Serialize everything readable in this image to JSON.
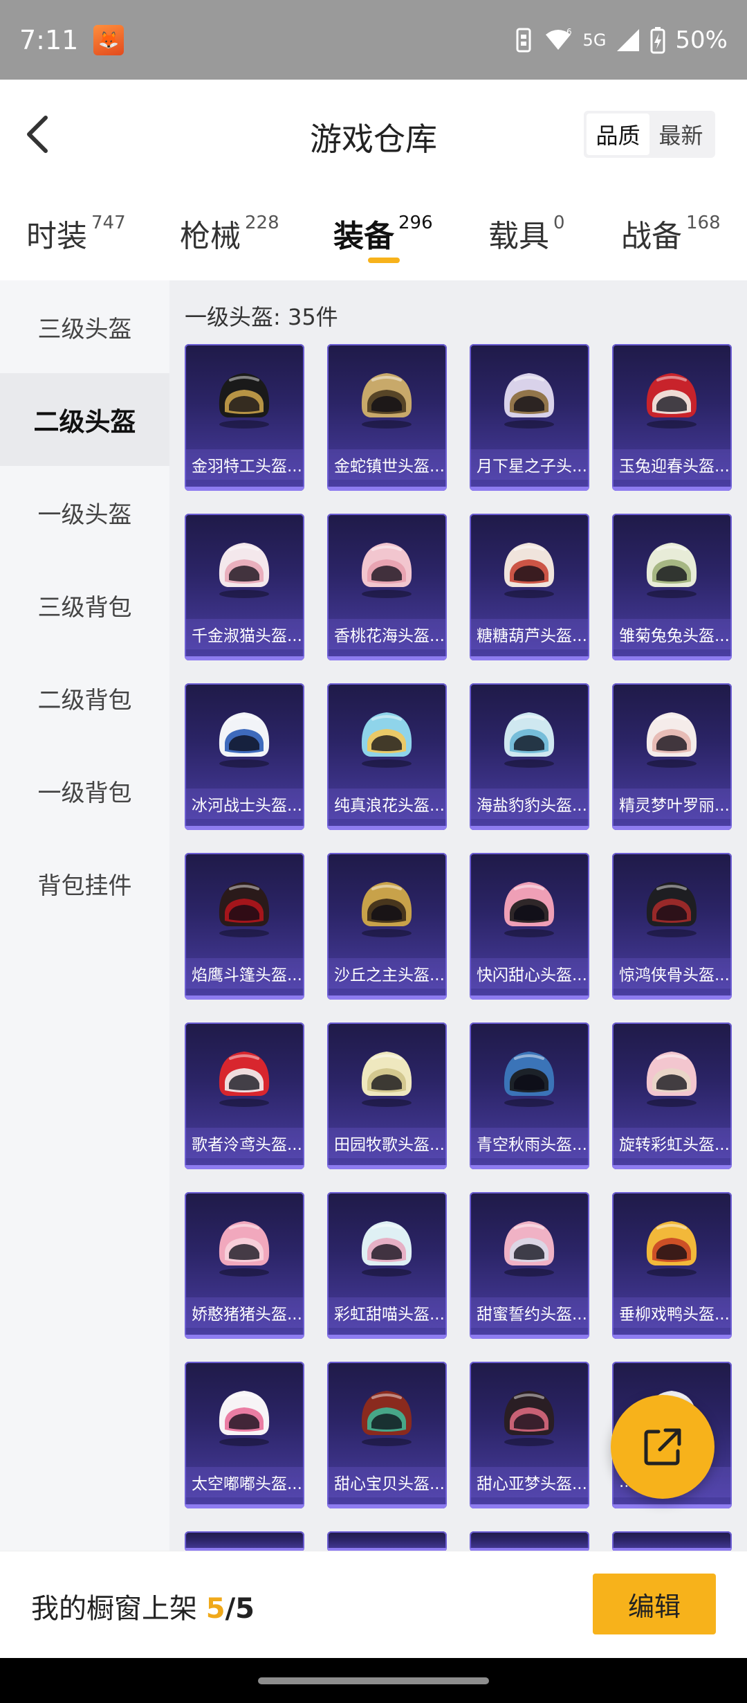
{
  "status_bar": {
    "time": "7:11",
    "battery": "50%",
    "network": "5G"
  },
  "header": {
    "title": "游戏仓库",
    "sort_options": [
      "品质",
      "最新"
    ]
  },
  "tabs": [
    {
      "label": "时装",
      "count": "747"
    },
    {
      "label": "枪械",
      "count": "228"
    },
    {
      "label": "装备",
      "count": "296",
      "active": true
    },
    {
      "label": "载具",
      "count": "0"
    },
    {
      "label": "战备",
      "count": "168"
    }
  ],
  "sidebar": {
    "items": [
      "三级头盔",
      "二级头盔",
      "一级头盔",
      "三级背包",
      "二级背包",
      "一级背包",
      "背包挂件"
    ],
    "active_index": 1
  },
  "content": {
    "section_title": "一级头盔: 35件",
    "items": [
      {
        "name": "金羽特工头盔...",
        "color": "#1a1a1a",
        "accent": "#c9a24a"
      },
      {
        "name": "金蛇镇世头盔...",
        "color": "#c8a96a",
        "accent": "#4a3a20"
      },
      {
        "name": "月下星之子头...",
        "color": "#d9d2ea",
        "accent": "#8a6a3a"
      },
      {
        "name": "玉兔迎春头盔...",
        "color": "#c8232b",
        "accent": "#f2efe8"
      },
      {
        "name": "千金淑猫头盔...",
        "color": "#f4e8ec",
        "accent": "#e8a8b8"
      },
      {
        "name": "香桃花海头盔...",
        "color": "#f2c6cf",
        "accent": "#e7a0ae"
      },
      {
        "name": "糖糖葫芦头盔...",
        "color": "#f0e4dc",
        "accent": "#c84535"
      },
      {
        "name": "雏菊兔兔头盔...",
        "color": "#e8ecd8",
        "accent": "#9fb17a"
      },
      {
        "name": "冰河战士头盔...",
        "color": "#f2f4f8",
        "accent": "#2a5bb5"
      },
      {
        "name": "纯真浪花头盔...",
        "color": "#8fd4ea",
        "accent": "#f3c85a"
      },
      {
        "name": "海盐豹豹头盔...",
        "color": "#cfe8f0",
        "accent": "#6bb8d6"
      },
      {
        "name": "精灵梦叶罗丽...",
        "color": "#f5ecea",
        "accent": "#e6b7b0"
      },
      {
        "name": "焰鹰斗篷头盔...",
        "color": "#2a1a1a",
        "accent": "#b1151c"
      },
      {
        "name": "沙丘之主头盔...",
        "color": "#c8a24a",
        "accent": "#3a2a18"
      },
      {
        "name": "快闪甜心头盔...",
        "color": "#ef9fb6",
        "accent": "#1a1a1a"
      },
      {
        "name": "惊鸿侠骨头盔...",
        "color": "#1e1e22",
        "accent": "#a52a2a"
      },
      {
        "name": "歌者泠鸢头盔...",
        "color": "#d8262e",
        "accent": "#f2f2f2"
      },
      {
        "name": "田园牧歌头盔...",
        "color": "#efe8bf",
        "accent": "#cfc48a"
      },
      {
        "name": "青空秋雨头盔...",
        "color": "#3b74b8",
        "accent": "#1a1a1a"
      },
      {
        "name": "旋转彩虹头盔...",
        "color": "#f3c6cf",
        "accent": "#e8d6c6"
      },
      {
        "name": "娇憨猪猪头盔...",
        "color": "#f1a8bd",
        "accent": "#f7d1dc"
      },
      {
        "name": "彩虹甜喵头盔...",
        "color": "#dff0f4",
        "accent": "#e7a8c0"
      },
      {
        "name": "甜蜜誓约头盔...",
        "color": "#f0b2c5",
        "accent": "#d9d9e8"
      },
      {
        "name": "垂柳戏鸭头盔...",
        "color": "#f2b83a",
        "accent": "#c94525"
      },
      {
        "name": "太空嘟嘟头盔...",
        "color": "#f7f4f6",
        "accent": "#e8709a"
      },
      {
        "name": "甜心宝贝头盔...",
        "color": "#8a2a1e",
        "accent": "#3fb594"
      },
      {
        "name": "甜心亚梦头盔...",
        "color": "#2a1e24",
        "accent": "#d9687e"
      },
      {
        "name": "...",
        "color": "#eeeef2",
        "accent": "#f2c64a"
      }
    ]
  },
  "bottom_bar": {
    "showcase_label": "我的橱窗上架 ",
    "current": "5",
    "separator": "/",
    "total": "5",
    "edit_label": "编辑"
  }
}
